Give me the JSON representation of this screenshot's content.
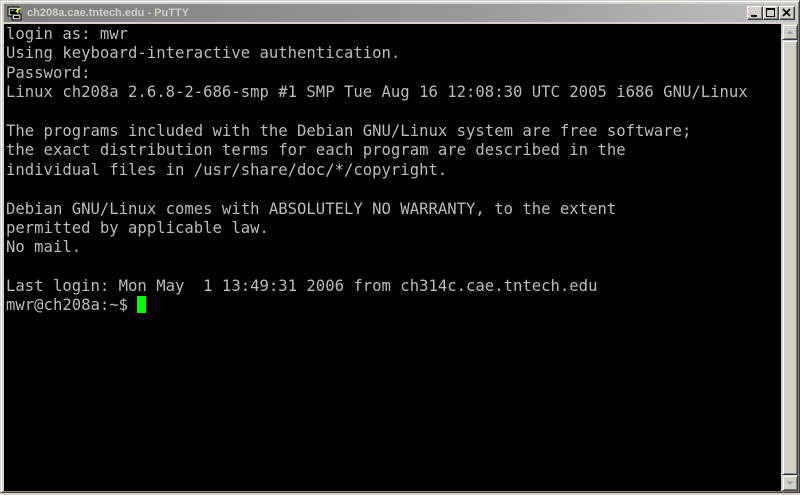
{
  "window": {
    "title": "ch208a.cae.tntech.edu - PuTTY",
    "icon": "putty-terminal-icon"
  },
  "caption_buttons": {
    "minimize_icon": "minimize-icon",
    "maximize_icon": "maximize-icon",
    "close_icon": "close-icon"
  },
  "terminal": {
    "lines": [
      "login as: mwr",
      "Using keyboard-interactive authentication.",
      "Password:",
      "Linux ch208a 2.6.8-2-686-smp #1 SMP Tue Aug 16 12:08:30 UTC 2005 i686 GNU/Linux",
      "",
      "The programs included with the Debian GNU/Linux system are free software;",
      "the exact distribution terms for each program are described in the",
      "individual files in /usr/share/doc/*/copyright.",
      "",
      "Debian GNU/Linux comes with ABSOLUTELY NO WARRANTY, to the extent",
      "permitted by applicable law.",
      "No mail.",
      "",
      "Last login: Mon May  1 13:49:31 2006 from ch314c.cae.tntech.edu"
    ],
    "prompt": "mwr@ch208a:~$ ",
    "foreground_color": "#bbbbbb",
    "background_color": "#000000",
    "cursor_color": "#00ff00"
  }
}
